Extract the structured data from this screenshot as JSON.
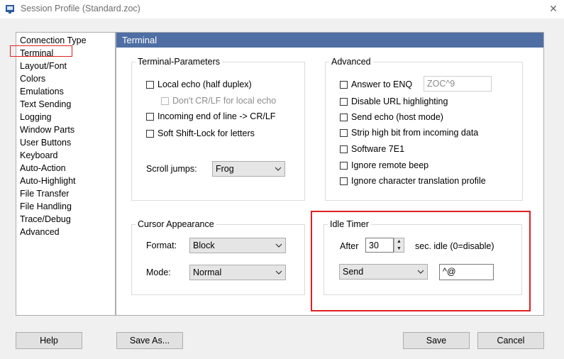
{
  "window": {
    "title": "Session Profile (Standard.zoc)",
    "close_glyph": "✕"
  },
  "sidebar": {
    "selected_index": 1,
    "items": [
      {
        "label": "Connection Type"
      },
      {
        "label": "Terminal"
      },
      {
        "label": "Layout/Font"
      },
      {
        "label": "Colors"
      },
      {
        "label": "Emulations"
      },
      {
        "label": "Text Sending"
      },
      {
        "label": "Logging"
      },
      {
        "label": "Window Parts"
      },
      {
        "label": "User Buttons"
      },
      {
        "label": "Keyboard"
      },
      {
        "label": "Auto-Action"
      },
      {
        "label": "Auto-Highlight"
      },
      {
        "label": "File Transfer"
      },
      {
        "label": "File Handling"
      },
      {
        "label": "Trace/Debug"
      },
      {
        "label": "Advanced"
      }
    ]
  },
  "panel": {
    "header": "Terminal",
    "header_color": "#4f6fa4"
  },
  "terminal_params": {
    "title": "Terminal-Parameters",
    "local_echo": {
      "label": "Local echo (half duplex)",
      "checked": false
    },
    "dont_crlf": {
      "label": "Don't CR/LF for local echo",
      "checked": false,
      "enabled": false
    },
    "incoming_eol": {
      "label": "Incoming end of line -> CR/LF",
      "checked": false
    },
    "soft_shift": {
      "label": "Soft Shift-Lock for letters",
      "checked": false
    },
    "scroll_jumps_label": "Scroll jumps:",
    "scroll_jumps_value": "Frog"
  },
  "advanced": {
    "title": "Advanced",
    "answer_enq": {
      "label": "Answer to ENQ",
      "checked": false
    },
    "answer_enq_value": "ZOC^9",
    "disable_url": {
      "label": "Disable URL highlighting",
      "checked": false
    },
    "send_echo": {
      "label": "Send echo (host mode)",
      "checked": false
    },
    "strip_high_bit": {
      "label": "Strip high bit from incoming data",
      "checked": false
    },
    "software_7e1": {
      "label": "Software 7E1",
      "checked": false
    },
    "ignore_beep": {
      "label": "Ignore remote beep",
      "checked": false
    },
    "ignore_translation": {
      "label": "Ignore character translation profile",
      "checked": false
    }
  },
  "cursor": {
    "title": "Cursor Appearance",
    "format_label": "Format:",
    "format_value": "Block",
    "mode_label": "Mode:",
    "mode_value": "Normal"
  },
  "idle_timer": {
    "title": "Idle Timer",
    "after_label": "After",
    "seconds_value": "30",
    "suffix_label": "sec. idle (0=disable)",
    "action_value": "Send",
    "send_text": "^@",
    "highlight_color": "#e02020"
  },
  "buttons": {
    "help": "Help",
    "save_as": "Save As...",
    "save": "Save",
    "cancel": "Cancel"
  }
}
